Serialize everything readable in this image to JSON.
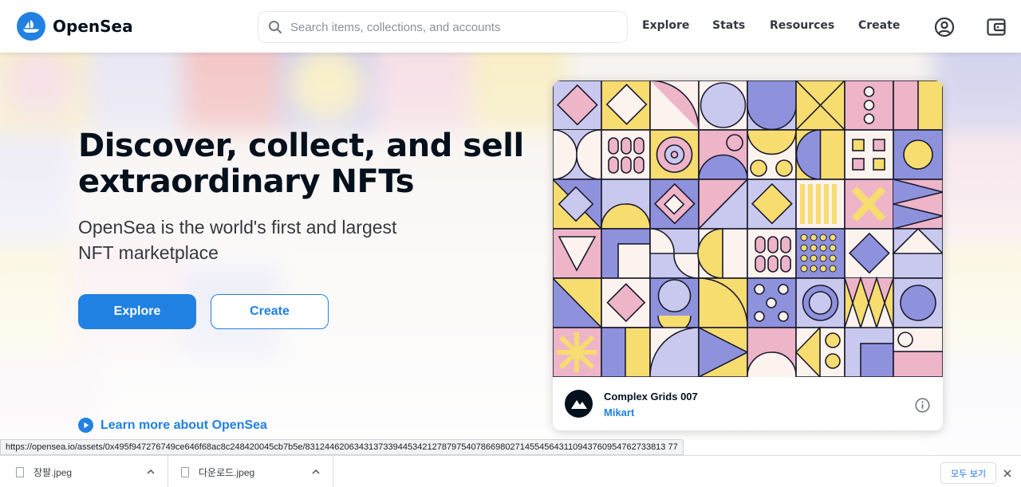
{
  "brand": {
    "name": "OpenSea",
    "accent": "#2081e2",
    "text": "#04111d"
  },
  "search": {
    "placeholder": "Search items, collections, and accounts"
  },
  "nav": {
    "items": [
      "Explore",
      "Stats",
      "Resources",
      "Create"
    ]
  },
  "header_icons": [
    "account-icon",
    "wallet-icon"
  ],
  "hero": {
    "headline": "Discover, collect, and sell extraordinary NFTs",
    "subheadline": "OpenSea is the world's first and largest NFT marketplace",
    "primary_button": "Explore",
    "secondary_button": "Create",
    "learn_more": "Learn more about OpenSea"
  },
  "featured": {
    "title": "Complex Grids 007",
    "creator": "Mikart",
    "palette": {
      "yellow": "#f7dc6f",
      "pink": "#eeb4c8",
      "lavender": "#c9c8ee",
      "blue": "#8e92dd",
      "cream": "#fdf3ee",
      "outline": "#1b1b2e"
    }
  },
  "status_url": "https://opensea.io/assets/0x495f947276749ce646f68ac8c248420045cb7b5e/83124462063431373394453421278797540786698027145545643110943760954762733813 77",
  "downloads": {
    "items": [
      {
        "name": "장팔.jpeg"
      },
      {
        "name": "다운로드.jpeg"
      }
    ],
    "show_all": "모두 보기"
  }
}
